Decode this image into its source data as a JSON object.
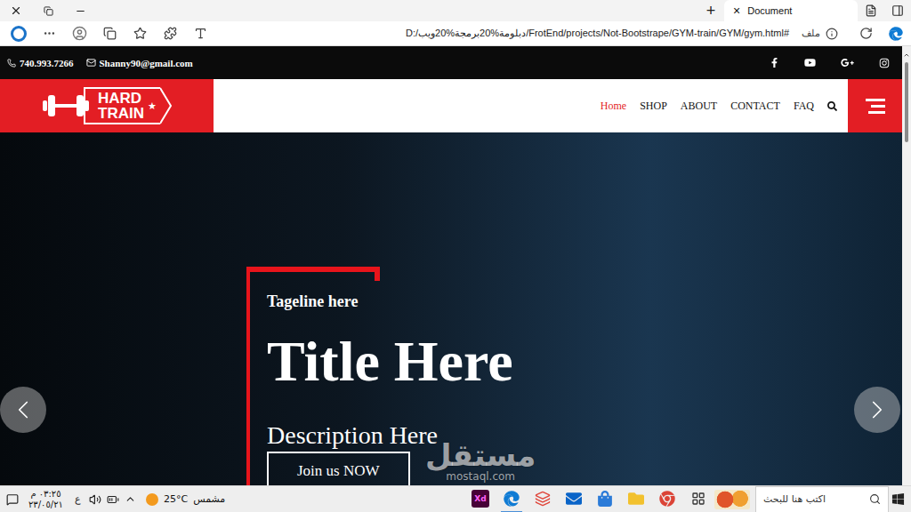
{
  "browser": {
    "new_tab": "+",
    "tabs": [
      {
        "title": "Document",
        "close": "×",
        "selected": true
      }
    ],
    "address": {
      "url": "D:/دبلومة%20برمجة%20ويب/FrotEnd/projects/Not-Bootstrape/GYM-train/GYM/gym.html#",
      "scheme_label": "ملف"
    }
  },
  "page": {
    "contact": {
      "phone": "740.993.7266",
      "email": "Shanny90@gmail.com"
    },
    "logo": {
      "line1": "HARD",
      "line2": "TRAIN",
      "mark": "★"
    },
    "nav": [
      {
        "label": "Home",
        "selected": true
      },
      {
        "label": "SHOP",
        "selected": false
      },
      {
        "label": "ABOUT",
        "selected": false
      },
      {
        "label": "CONTACT",
        "selected": false
      },
      {
        "label": "FAQ",
        "selected": false
      }
    ],
    "hero": {
      "tagline": "Tageline here",
      "title": "Title Here",
      "description": "Description Here",
      "button": "Join us NOW"
    }
  },
  "watermark": {
    "name": "مستقل",
    "site": "mostaql.com"
  },
  "taskbar": {
    "search_placeholder": "اكتب هنا للبحث",
    "weather": {
      "temp": "25°C",
      "condition": "مشمس"
    },
    "language": "ع",
    "time": "٠٣:٢٥ م",
    "date": "٢٣/٠٥/٢١",
    "apps": [
      {
        "kind": "xd",
        "label": "Xd",
        "color": "#470137",
        "active": false
      },
      {
        "kind": "edge",
        "color": "#0f7bd4",
        "active": true
      },
      {
        "kind": "app",
        "color": "#e0453a",
        "active": false
      },
      {
        "kind": "mail",
        "color": "#0a64c8",
        "active": false
      },
      {
        "kind": "store",
        "color": "#2b7bd8",
        "active": false
      },
      {
        "kind": "folder",
        "color": "#f2c12e",
        "active": false
      },
      {
        "kind": "chrome",
        "color": "#db4437",
        "active": false
      }
    ]
  }
}
